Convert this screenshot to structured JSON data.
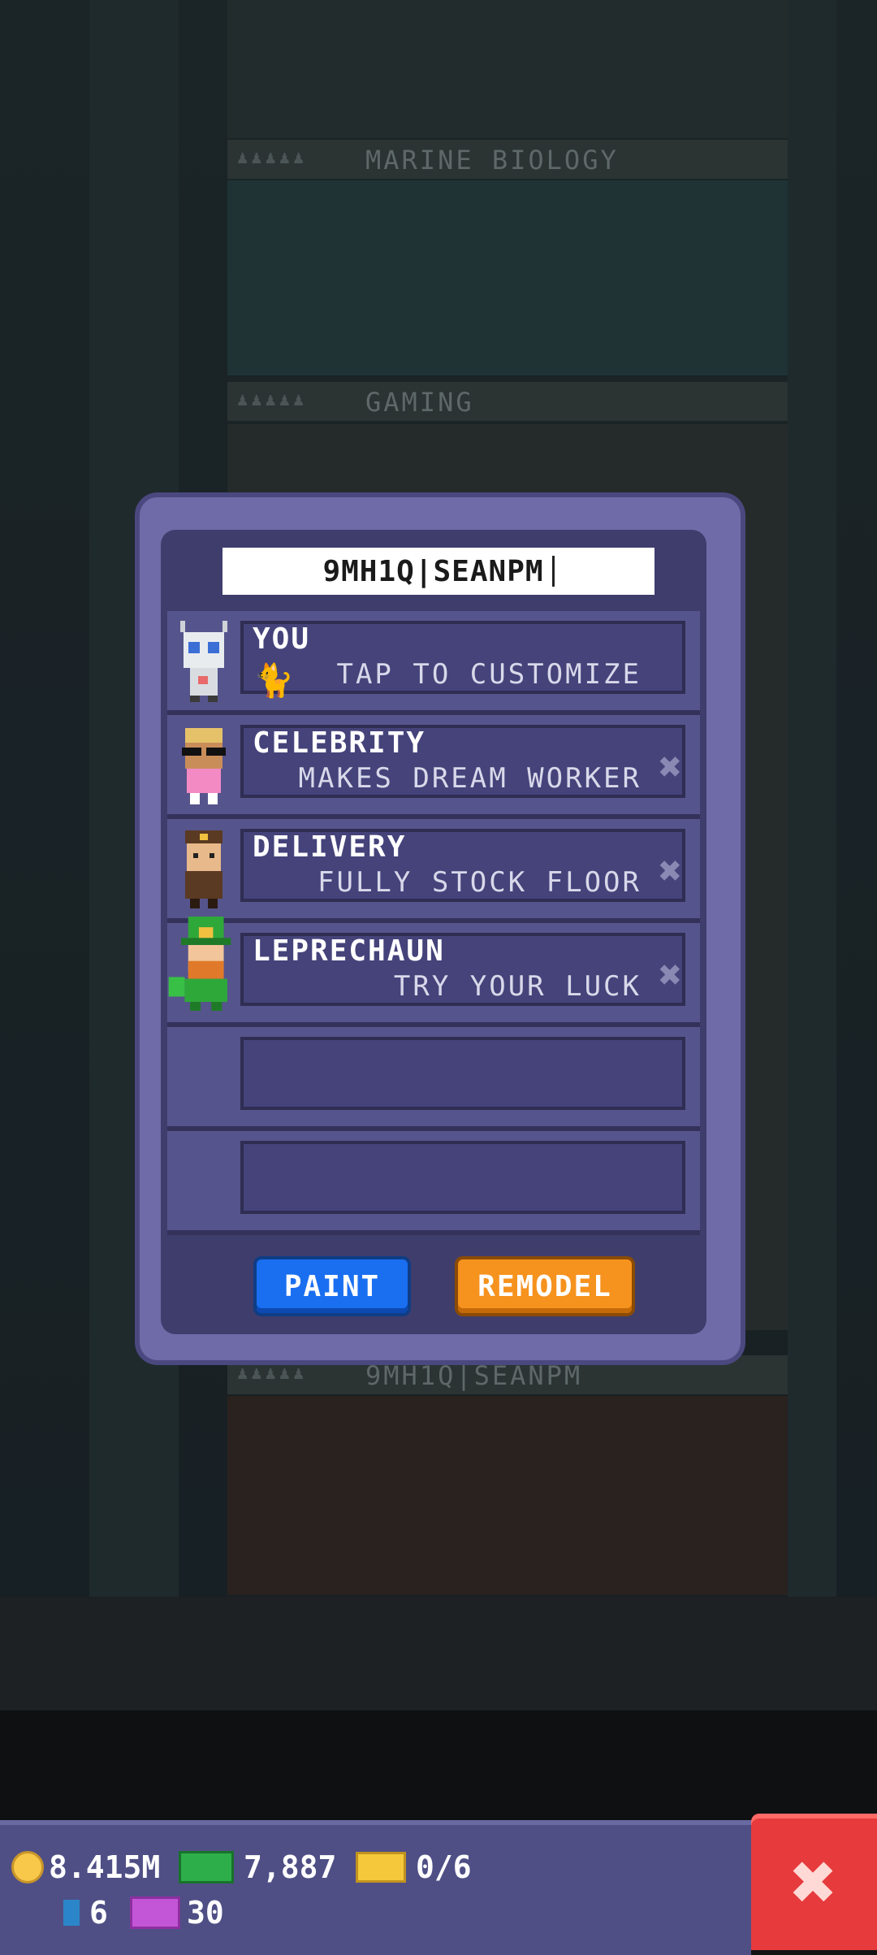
{
  "background": {
    "floors": [
      "MARINE BIOLOGY",
      "GAMING",
      "9MH1Q|SEANPM"
    ]
  },
  "dialog": {
    "name_field": "9MH1Q|SEANPM",
    "rows": [
      {
        "title": "YOU",
        "subtitle": "TAP TO CUSTOMIZE",
        "avatar": "robot-avatar",
        "removable": false
      },
      {
        "title": "CELEBRITY",
        "subtitle": "MAKES DREAM WORKER",
        "avatar": "celebrity-avatar",
        "removable": true
      },
      {
        "title": "DELIVERY",
        "subtitle": "FULLY STOCK FLOOR",
        "avatar": "delivery-avatar",
        "removable": true
      },
      {
        "title": "LEPRECHAUN",
        "subtitle": "TRY YOUR LUCK",
        "avatar": "leprechaun-avatar",
        "removable": true
      },
      {
        "title": "",
        "subtitle": "",
        "avatar": "",
        "removable": false
      },
      {
        "title": "",
        "subtitle": "",
        "avatar": "",
        "removable": false
      }
    ],
    "paint_label": "PAINT",
    "remodel_label": "REMODEL",
    "remove_glyph": "✖"
  },
  "hud": {
    "coins": "8.415M",
    "bux": "7,887",
    "tickets": "0/6",
    "gems": "6",
    "vip": "30",
    "close_glyph": "✖"
  },
  "colors": {
    "paint_button": "#1a6ff0",
    "remodel_button": "#f6921e",
    "close_button": "#e63a3c"
  }
}
